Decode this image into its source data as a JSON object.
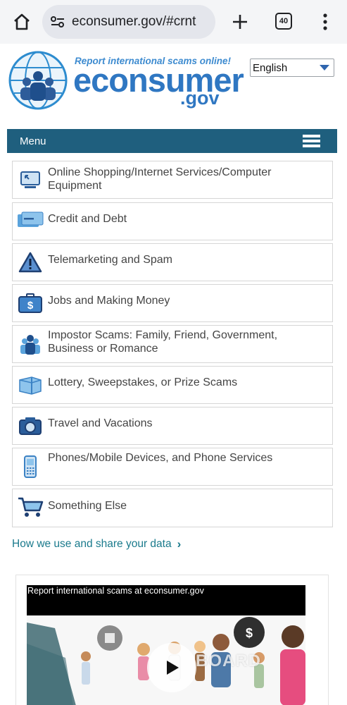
{
  "browser": {
    "url": "econsumer.gov/#crnt",
    "tab_count": "40"
  },
  "header": {
    "tagline": "Report international scams online!",
    "logo_word": "econsumer",
    "logo_suffix": ".gov",
    "language": "English"
  },
  "menu": {
    "label": "Menu"
  },
  "categories": [
    {
      "label": "Online Shopping/Internet Services/Computer Equipment",
      "icon": "computer-icon"
    },
    {
      "label": "Credit and Debt",
      "icon": "credit-card-icon"
    },
    {
      "label": "Telemarketing and Spam",
      "icon": "warning-icon"
    },
    {
      "label": "Jobs and Making Money",
      "icon": "briefcase-icon"
    },
    {
      "label": "Impostor Scams: Family, Friend, Government, Business or Romance",
      "icon": "people-icon"
    },
    {
      "label": "Lottery, Sweepstakes, or Prize Scams",
      "icon": "gift-icon"
    },
    {
      "label": "Travel and Vacations",
      "icon": "camera-icon"
    },
    {
      "label": "Phones/Mobile Devices, and Phone Services",
      "icon": "phone-icon"
    },
    {
      "label": "Something Else",
      "icon": "cart-icon"
    }
  ],
  "links": {
    "data_use": "How we use and share your data"
  },
  "video": {
    "title": "Report international scams at econsumer.gov",
    "watermark": "BOARD"
  },
  "colors": {
    "menu_bar": "#1f5f7e",
    "link": "#1a7a8c",
    "brand": "#2f77c2"
  }
}
